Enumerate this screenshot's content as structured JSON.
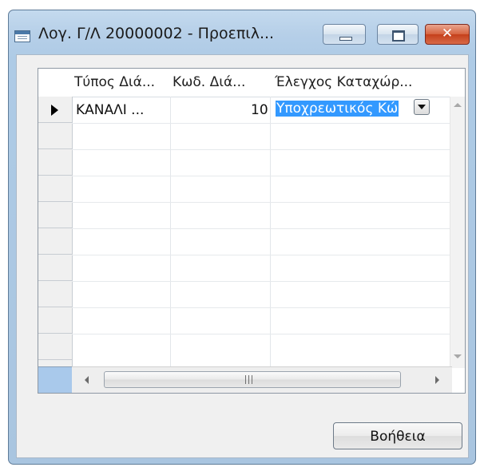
{
  "window": {
    "title": "Λογ. Γ/Λ 20000002 - Προεπιλ...",
    "app_icon": "table-window-icon",
    "controls": {
      "minimize": "minimize-icon",
      "maximize": "maximize-icon",
      "close": "✕"
    }
  },
  "grid": {
    "columns": [
      "Τύπος Διά...",
      "Κωδ. Διά...",
      "Έλεγχος Καταχώρ..."
    ],
    "rows": [
      {
        "col1": "ΚΑΝΑΛΙ ...",
        "col2": "10",
        "col3": "Υποχρεωτικός Κώ"
      }
    ],
    "scroll_grip_icon": "III"
  },
  "buttons": {
    "help": "Βοήθεια"
  }
}
